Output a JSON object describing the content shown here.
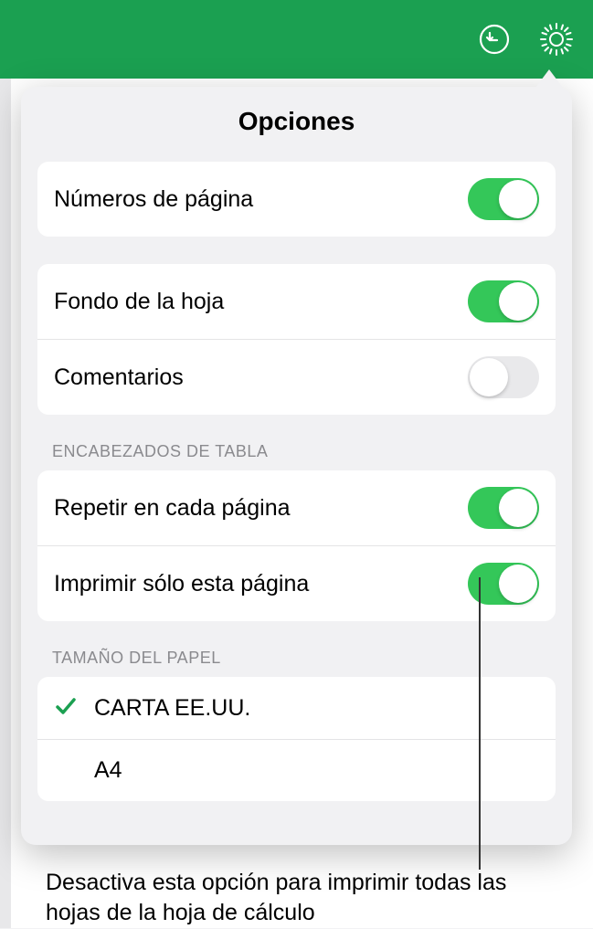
{
  "popover": {
    "title": "Opciones",
    "sections": {
      "general": {
        "page_numbers": {
          "label": "Números de página",
          "on": true
        },
        "sheet_background": {
          "label": "Fondo de la hoja",
          "on": true
        },
        "comments": {
          "label": "Comentarios",
          "on": false
        }
      },
      "table_headers": {
        "title": "Encabezados de tabla",
        "repeat_each_page": {
          "label": "Repetir en cada página",
          "on": true
        },
        "print_only_this_page": {
          "label": "Imprimir sólo esta página",
          "on": true
        }
      },
      "paper_size": {
        "title": "Tamaño del papel",
        "options": {
          "us_letter": {
            "label": "CARTA EE.UU.",
            "selected": true
          },
          "a4": {
            "label": "A4",
            "selected": false
          }
        }
      }
    }
  },
  "callout": {
    "text": "Desactiva esta opción para imprimir todas las hojas de la hoja de cálculo"
  }
}
